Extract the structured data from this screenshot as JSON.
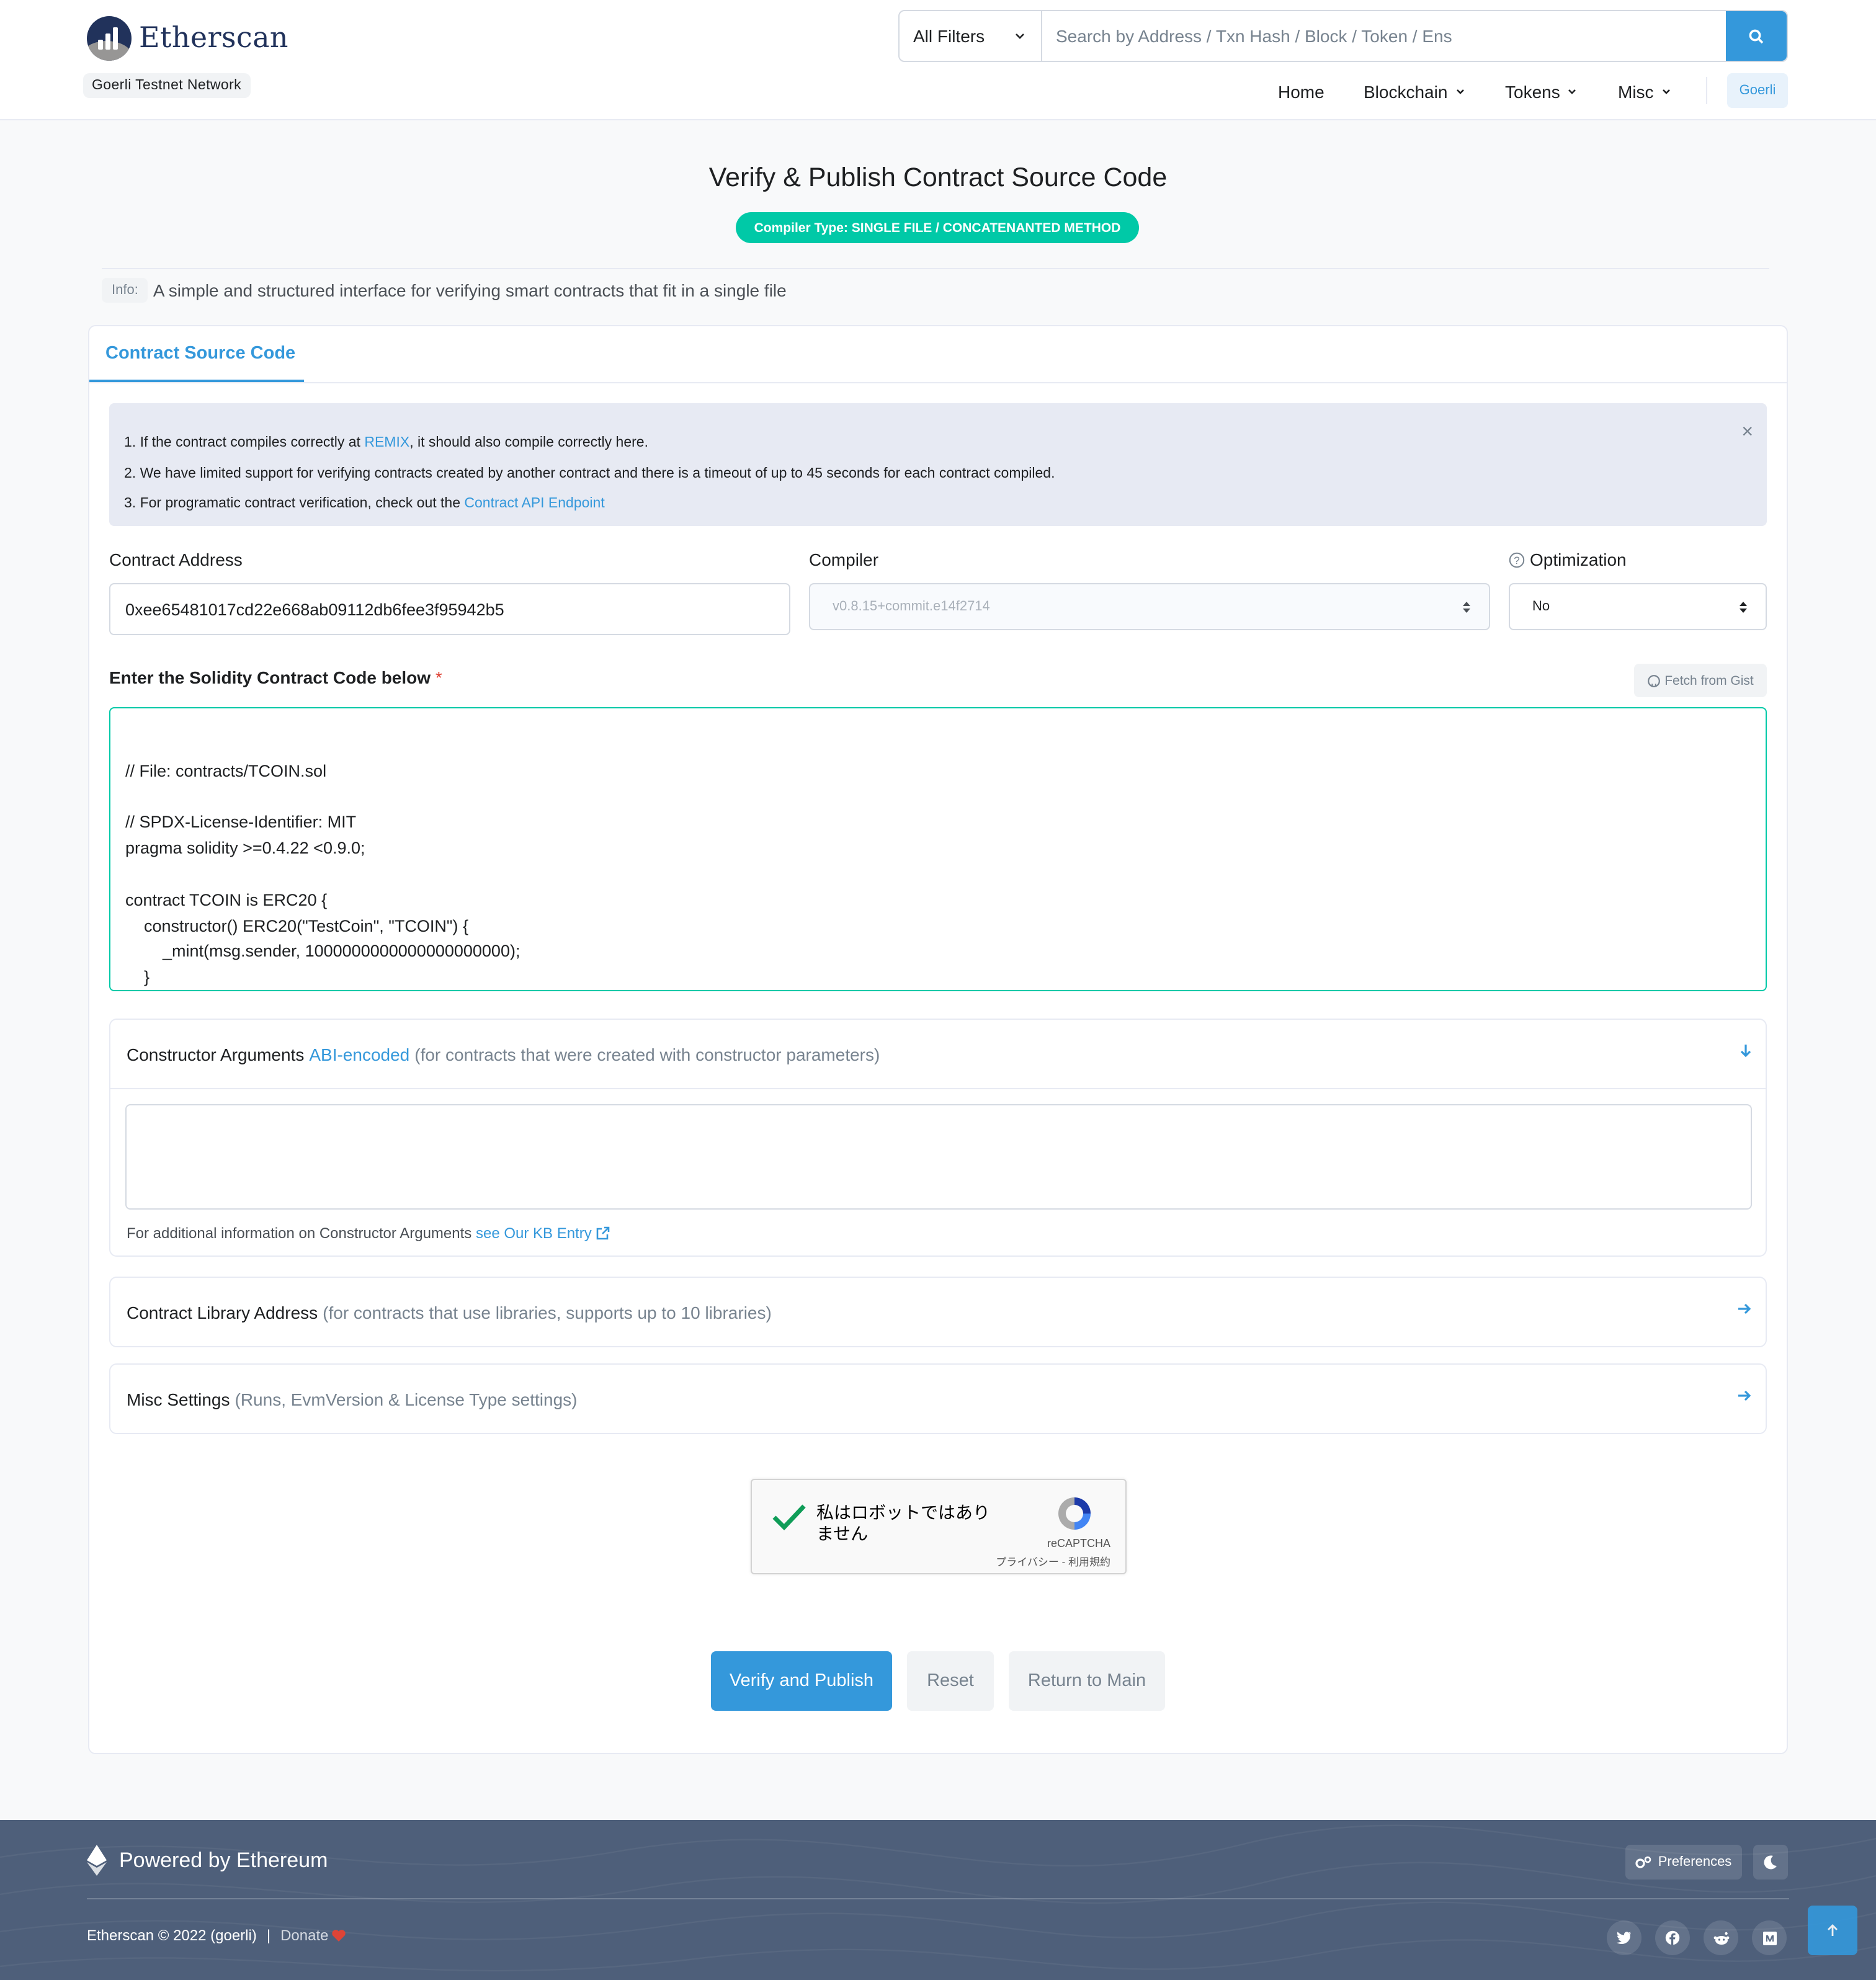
{
  "header": {
    "logo_text": "Etherscan",
    "network_badge": "Goerli Testnet Network",
    "search": {
      "filter_label": "All Filters",
      "placeholder": "Search by Address / Txn Hash / Block / Token / Ens"
    },
    "nav": {
      "home": "Home",
      "blockchain": "Blockchain",
      "tokens": "Tokens",
      "misc": "Misc",
      "network_button": "Goerli"
    }
  },
  "page": {
    "title": "Verify & Publish Contract Source Code",
    "compiler_type_badge": "Compiler Type: SINGLE FILE / CONCATENANTED METHOD",
    "info_tag": "Info:",
    "info_text": "A simple and structured interface for verifying smart contracts that fit in a single file"
  },
  "card": {
    "tab_label": "Contract Source Code",
    "alert": {
      "line1_prefix": "1. If the contract compiles correctly at ",
      "line1_link": "REMIX",
      "line1_suffix": ", it should also compile correctly here.",
      "line2": "2. We have limited support for verifying contracts created by another contract and there is a timeout of up to 45 seconds for each contract compiled.",
      "line3_prefix": "3. For programatic contract verification, check out the ",
      "line3_link": "Contract API Endpoint",
      "close_glyph": "×"
    },
    "contract_address_label": "Contract Address",
    "contract_address_value": "0xee65481017cd22e668ab09112db6fee3f95942b5",
    "compiler_label": "Compiler",
    "compiler_value": "v0.8.15+commit.e14f2714",
    "optimization_label": "Optimization",
    "optimization_value": "No",
    "code_label": "Enter the Solidity Contract Code below",
    "required_mark": "*",
    "fetch_gist_label": "Fetch from Gist",
    "code_text": "\n// File: contracts/TCOIN.sol\n\n// SPDX-License-Identifier: MIT\npragma solidity >=0.4.22 <0.9.0;\n\ncontract TCOIN is ERC20 {\n    constructor() ERC20(\"TestCoin\", \"TCOIN\") {\n        _mint(msg.sender, 1000000000000000000000);\n    }\n}",
    "constructor_args": {
      "title": "Constructor Arguments",
      "link": "ABI-encoded",
      "muted": "(for contracts that were created with constructor parameters)",
      "kb_prefix": "For additional information on Constructor Arguments",
      "kb_link": "see Our KB Entry"
    },
    "library": {
      "title": "Contract Library Address",
      "muted": "(for contracts that use libraries, supports up to 10 libraries)"
    },
    "misc": {
      "title": "Misc Settings",
      "muted": "(Runs, EvmVersion & License Type settings)"
    },
    "captcha": {
      "text": "私はロボットではありません",
      "brand": "reCAPTCHA",
      "terms": "プライバシー - 利用規約"
    },
    "buttons": {
      "verify": "Verify and Publish",
      "reset": "Reset",
      "return": "Return to Main"
    }
  },
  "footer": {
    "powered_by": "Powered by Ethereum",
    "preferences": "Preferences",
    "copyright": "Etherscan © 2022 (goerli)",
    "separator": "|",
    "donate": "Donate"
  },
  "colors": {
    "primary": "#3498db",
    "teal": "#00c9a7",
    "footer_bg": "#4e5f7a"
  }
}
